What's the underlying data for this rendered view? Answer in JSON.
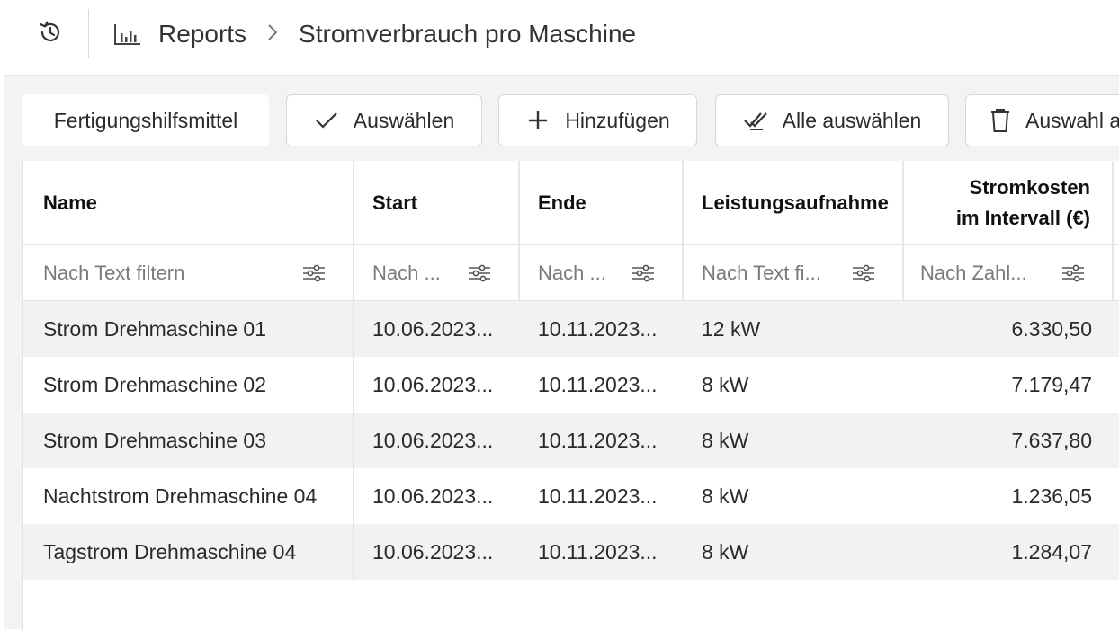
{
  "header": {
    "breadcrumb": {
      "root": "Reports",
      "current": "Stromverbrauch pro Maschine"
    },
    "icons": {
      "history": "history-icon",
      "reports": "bar-chart-icon",
      "separator": "chevron-right-icon"
    }
  },
  "toolbar": {
    "chip_label": "Fertigungshilfsmittel",
    "select_label": "Auswählen",
    "add_label": "Hinzufügen",
    "select_all_label": "Alle auswählen",
    "clear_label": "Auswahl a"
  },
  "table": {
    "columns": [
      {
        "label": "Name",
        "filter_placeholder": "Nach Text filtern"
      },
      {
        "label": "Start",
        "filter_placeholder": "Nach ..."
      },
      {
        "label": "Ende",
        "filter_placeholder": "Nach ..."
      },
      {
        "label": "Leistungsaufnahme",
        "filter_placeholder": "Nach Text fi..."
      },
      {
        "label_line1": "Stromkosten",
        "label_line2": "im Intervall (€)",
        "filter_placeholder": "Nach Zahl..."
      }
    ],
    "rows": [
      {
        "name": "Strom Drehmaschine 01",
        "start": "10.06.2023...",
        "end": "10.11.2023...",
        "power": "12 kW",
        "cost": "6.330,50"
      },
      {
        "name": "Strom Drehmaschine 02",
        "start": "10.06.2023...",
        "end": "10.11.2023...",
        "power": "8 kW",
        "cost": "7.179,47"
      },
      {
        "name": "Strom Drehmaschine 03",
        "start": "10.06.2023...",
        "end": "10.11.2023...",
        "power": "8 kW",
        "cost": "7.637,80"
      },
      {
        "name": "Nachtstrom Drehmaschine 04",
        "start": "10.06.2023...",
        "end": "10.11.2023...",
        "power": "8 kW",
        "cost": "1.236,05"
      },
      {
        "name": "Tagstrom Drehmaschine 04",
        "start": "10.06.2023...",
        "end": "10.11.2023...",
        "power": "8 kW",
        "cost": "1.284,07"
      }
    ]
  },
  "colors": {
    "panel_bg": "#f3f3f3",
    "row_stripe": "#f2f2f2",
    "border": "#e3e3e3",
    "text": "#1f1f1f"
  }
}
